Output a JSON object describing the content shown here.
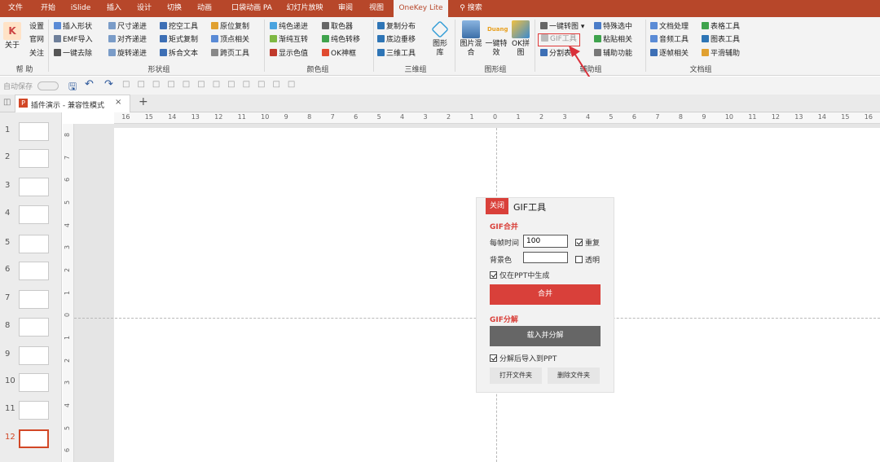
{
  "tabs": [
    "文件",
    "开始",
    "iSlide",
    "插入",
    "设计",
    "切换",
    "动画",
    "口袋动画 PA",
    "幻灯片放映",
    "审阅",
    "视图",
    "OneKey Lite"
  ],
  "search_label": "搜索",
  "ribbon": {
    "help": {
      "label": "帮 助",
      "about": "关于",
      "settings": "设置",
      "site": "官网",
      "follow": "关注"
    },
    "shape": {
      "label": "形状组",
      "items": [
        "插入形状",
        "EMF导入",
        "一键去除",
        "尺寸递进",
        "对齐递进",
        "旋转递进",
        "挖空工具",
        "矩式复制",
        "拆合文本",
        "原位复制",
        "顶点相关",
        "跨页工具"
      ]
    },
    "color": {
      "label": "颜色组",
      "items": [
        "纯色递进",
        "渐纯互转",
        "显示色值",
        "取色器",
        "纯色转移",
        "OK神框"
      ]
    },
    "three_d": {
      "label": "三维组",
      "items": [
        "复制分布",
        "底边垂移",
        "三维工具"
      ],
      "big": "图形\n库"
    },
    "image": {
      "label": "图形组",
      "items": [
        "图片混\n合",
        "一键特\n效",
        "OK拼\n图"
      ],
      "duang": "Duang"
    },
    "assist": {
      "label": "辅助组",
      "items": [
        "一键转图",
        "GIF工具",
        "分割表",
        "特殊选中",
        "粘贴相关",
        "辅助功能"
      ]
    },
    "doc": {
      "label": "文档组",
      "items": [
        "文档处理",
        "音频工具",
        "逐帧相关",
        "表格工具",
        "图表工具",
        "平滑辅助"
      ]
    }
  },
  "qat": {
    "autosave": "自动保存"
  },
  "doc_tab": {
    "title": "插件演示 - 兼容性模式"
  },
  "slides": [
    "1",
    "2",
    "3",
    "4",
    "5",
    "6",
    "7",
    "8",
    "9",
    "10",
    "11",
    "12"
  ],
  "active_slide": 12,
  "ruler_h": [
    "16",
    "15",
    "14",
    "13",
    "12",
    "11",
    "10",
    "9",
    "8",
    "7",
    "6",
    "5",
    "4",
    "3",
    "2",
    "1",
    "0",
    "1",
    "2",
    "3",
    "4",
    "5",
    "6",
    "7",
    "8",
    "9",
    "10",
    "11",
    "12",
    "13",
    "14",
    "15",
    "16"
  ],
  "ruler_v": [
    "8",
    "7",
    "6",
    "5",
    "4",
    "3",
    "2",
    "1",
    "0",
    "1",
    "2",
    "3",
    "4",
    "5",
    "6"
  ],
  "gif_panel": {
    "close": "关闭",
    "title": "GIF工具",
    "merge_heading": "GIF合并",
    "frame_time_label": "每帧时间",
    "frame_time_value": "100",
    "repeat_label": "重复",
    "bg_label": "背景色",
    "bg_value": "",
    "transparent_label": "透明",
    "only_ppt_label": "仅在PPT中生成",
    "merge_button": "合并",
    "split_heading": "GIF分解",
    "split_button": "载入并分解",
    "import_label": "分解后导入到PPT",
    "open_folder": "打开文件夹",
    "delete_folder": "删除文件夹"
  },
  "colors": {
    "brand": "#b7472a",
    "accent_red": "#d9403a",
    "dark_button": "#666666"
  }
}
